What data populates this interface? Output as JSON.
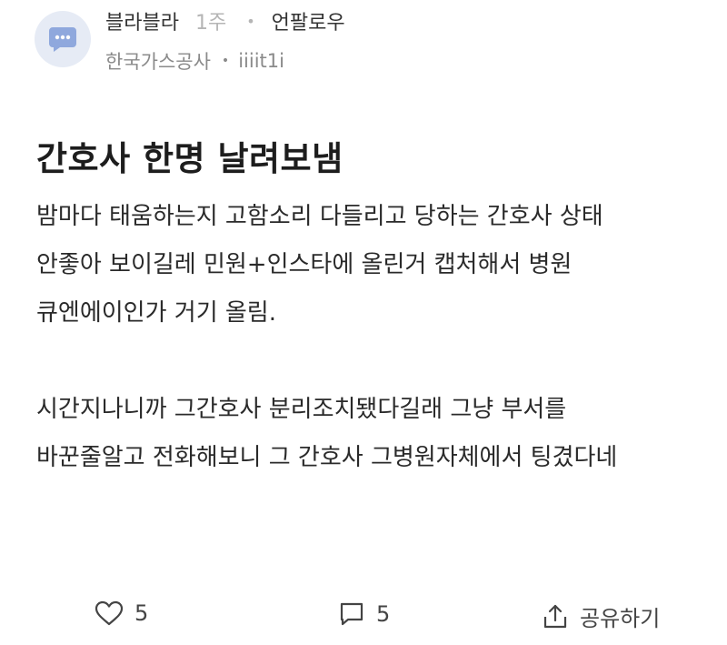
{
  "post": {
    "author": "블라블라",
    "time_ago": "1주",
    "follow_label": "언팔로우",
    "company": "한국가스공사",
    "user_id": "iiiit1i",
    "title": "간호사 한명 날려보냄",
    "body_lines": [
      "밤마다 태움하는지 고함소리 다들리고 당하는 간호사 상태",
      "안좋아 보이길레 민원+인스타에 올린거 캡처해서 병원",
      "큐엔에이인가 거기 올림.",
      "시간지나니까 그간호사 분리조치됐다길래 그냥 부서를",
      "바꾼줄알고 전화해보니 그 간호사 그병원자체에서 팅겼다네"
    ]
  },
  "actions": {
    "like_count": "5",
    "comment_count": "5",
    "share_label": "공유하기"
  },
  "icons": {
    "avatar": "chat-bubble-icon",
    "like": "heart-icon",
    "comment": "comment-icon",
    "share": "share-icon"
  },
  "colors": {
    "avatar_bg": "#e6ebf5",
    "avatar_icon": "#8fa8dd",
    "muted_text": "#b5b5b5"
  }
}
